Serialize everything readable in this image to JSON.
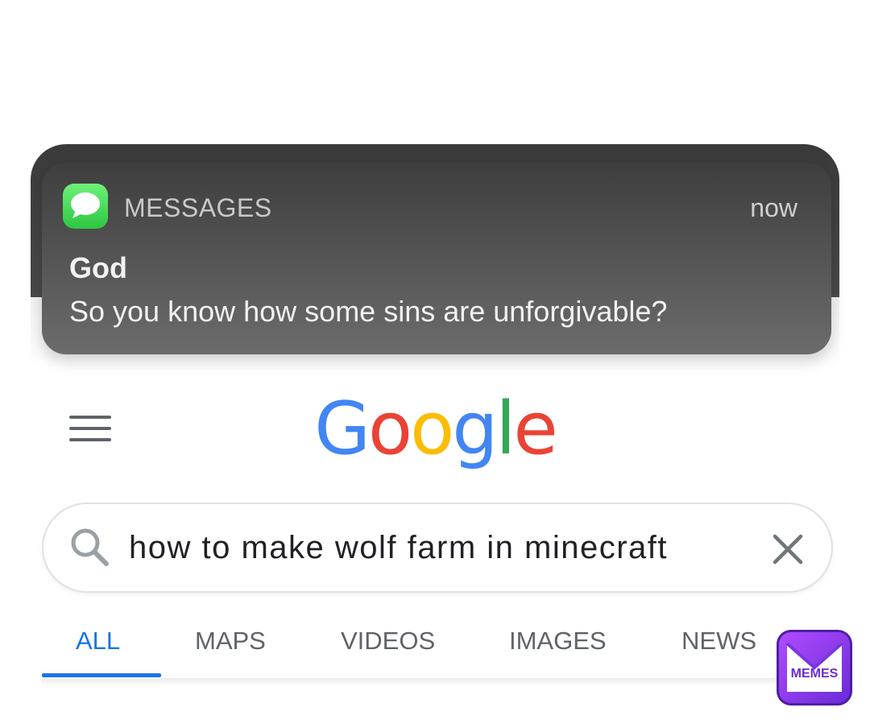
{
  "notification": {
    "app_name": "MESSAGES",
    "time": "now",
    "sender": "God",
    "message": "So you know how some sins are unforgivable?"
  },
  "header": {
    "logo_letters": [
      {
        "char": "G",
        "color": "#4285F4"
      },
      {
        "char": "o",
        "color": "#EA4335"
      },
      {
        "char": "o",
        "color": "#FBBC05"
      },
      {
        "char": "g",
        "color": "#4285F4"
      },
      {
        "char": "l",
        "color": "#34A853"
      },
      {
        "char": "e",
        "color": "#EA4335"
      }
    ]
  },
  "search": {
    "query": "how to make wolf farm in minecraft"
  },
  "tabs": [
    {
      "label": "ALL",
      "active": true
    },
    {
      "label": "MAPS",
      "active": false
    },
    {
      "label": "VIDEOS",
      "active": false
    },
    {
      "label": "IMAGES",
      "active": false
    },
    {
      "label": "NEWS",
      "active": false
    }
  ],
  "watermark": {
    "label": "MEMES"
  },
  "colors": {
    "accent": "#1a73e8",
    "tab_inactive": "#5f6368",
    "messages_green": "#34c759"
  }
}
